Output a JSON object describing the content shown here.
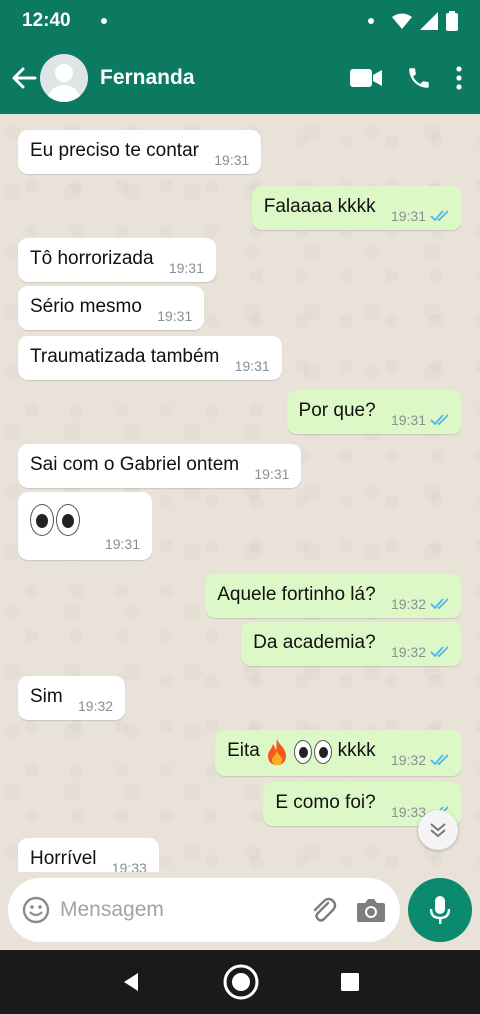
{
  "status": {
    "time": "12:40"
  },
  "header": {
    "contact_name": "Fernanda"
  },
  "messages": [
    {
      "dir": "in",
      "text": "Eu preciso te contar",
      "time": "19:31"
    },
    {
      "dir": "out",
      "text": "Falaaaa kkkk",
      "time": "19:31"
    },
    {
      "dir": "in",
      "text": "Tô horrorizada",
      "time": "19:31"
    },
    {
      "dir": "in",
      "text": "Sério mesmo",
      "time": "19:31"
    },
    {
      "dir": "in",
      "text": "Traumatizada também",
      "time": "19:31"
    },
    {
      "dir": "out",
      "text": "Por que?",
      "time": "19:31"
    },
    {
      "dir": "in",
      "text": "Sai com o Gabriel ontem",
      "time": "19:31"
    },
    {
      "dir": "in",
      "text": "",
      "emoji": "eyes",
      "time": "19:31"
    },
    {
      "dir": "out",
      "text": "Aquele fortinho lá?",
      "time": "19:32"
    },
    {
      "dir": "out",
      "text": "Da academia?",
      "time": "19:32"
    },
    {
      "dir": "in",
      "text": "Sim",
      "time": "19:32"
    },
    {
      "dir": "out",
      "text": "Eita",
      "text_suffix": "kkkk",
      "emoji": "fire-eyes",
      "time": "19:32"
    },
    {
      "dir": "out",
      "text": "E como foi?",
      "time": "19:33"
    },
    {
      "dir": "in",
      "text": "Horrível",
      "time": "19:33"
    }
  ],
  "input": {
    "placeholder": "Mensagem"
  },
  "icons": {
    "back": "arrow-left-icon",
    "video": "video-call-icon",
    "call": "phone-icon",
    "menu": "more-vert-icon",
    "emoji": "emoji-icon",
    "attach": "paperclip-icon",
    "camera": "camera-icon",
    "mic": "mic-icon",
    "read": "double-check-icon",
    "scroll": "chevron-double-down-icon"
  },
  "colors": {
    "header": "#0b7a61",
    "outgoing": "#dcf8c6",
    "incoming": "#ffffff",
    "tick_read": "#4fb6ec",
    "mic_button": "#0b8a6e"
  }
}
